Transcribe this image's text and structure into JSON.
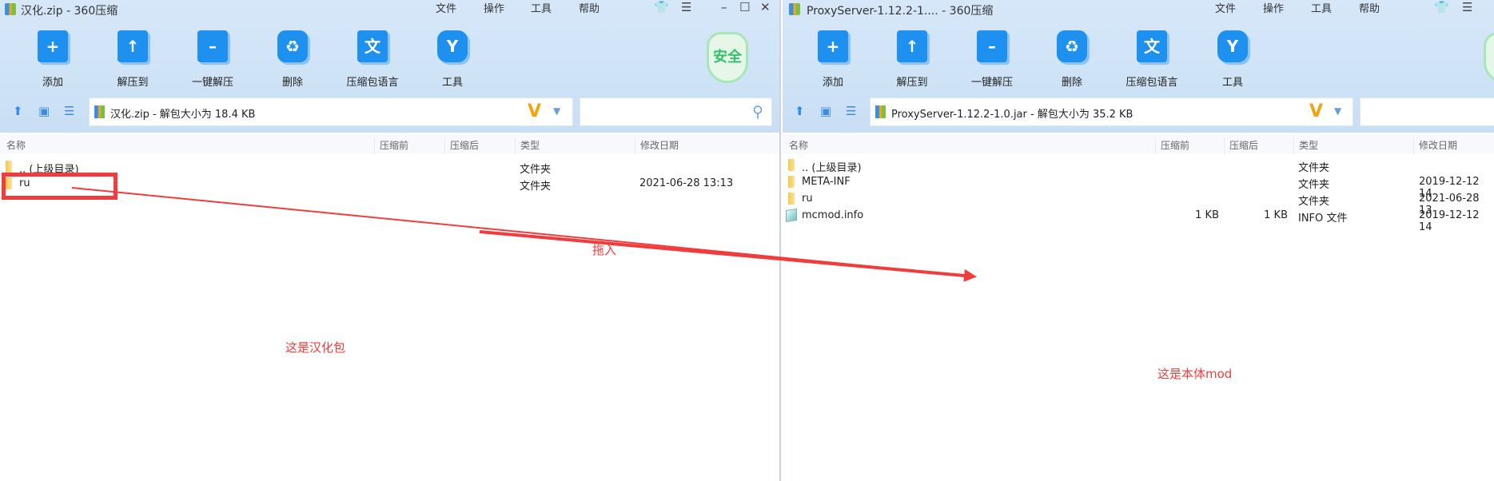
{
  "left": {
    "title": "汉化.zip - 360压缩",
    "menu": [
      "文件",
      "操作",
      "工具",
      "帮助"
    ],
    "toolbar": [
      "添加",
      "解压到",
      "一键解压",
      "删除",
      "压缩包语言",
      "工具"
    ],
    "badge": "安全",
    "address": "汉化.zip - 解包大小为 18.4 KB",
    "columns": [
      "名称",
      "压缩前",
      "压缩后",
      "类型",
      "修改日期"
    ],
    "rows": [
      {
        "name": ".. (上级目录)",
        "before": "",
        "after": "",
        "type": "文件夹",
        "date": ""
      },
      {
        "name": "ru",
        "before": "",
        "after": "",
        "type": "文件夹",
        "date": "2021-06-28 13:13"
      }
    ]
  },
  "right": {
    "title": "ProxyServer-1.12.2-1.... - 360压缩",
    "menu": [
      "文件",
      "操作",
      "工具",
      "帮助"
    ],
    "toolbar": [
      "添加",
      "解压到",
      "一键解压",
      "删除",
      "压缩包语言",
      "工具"
    ],
    "address": "ProxyServer-1.12.2-1.0.jar - 解包大小为 35.2 KB",
    "columns": [
      "名称",
      "压缩前",
      "压缩后",
      "类型",
      "修改日期"
    ],
    "rows": [
      {
        "name": ".. (上级目录)",
        "before": "",
        "after": "",
        "type": "文件夹",
        "date": ""
      },
      {
        "name": "META-INF",
        "before": "",
        "after": "",
        "type": "文件夹",
        "date": "2019-12-12 14"
      },
      {
        "name": "ru",
        "before": "",
        "after": "",
        "type": "文件夹",
        "date": "2021-06-28 13"
      },
      {
        "name": "mcmod.info",
        "before": "1 KB",
        "after": "1 KB",
        "type": "INFO 文件",
        "date": "2019-12-12 14"
      }
    ]
  },
  "annotations": {
    "drag": "拖入",
    "left_note": "这是汉化包",
    "right_note": "这是本体mod"
  },
  "colors": {
    "annotation": "#f03c3c",
    "accent": "#1e90f0"
  }
}
